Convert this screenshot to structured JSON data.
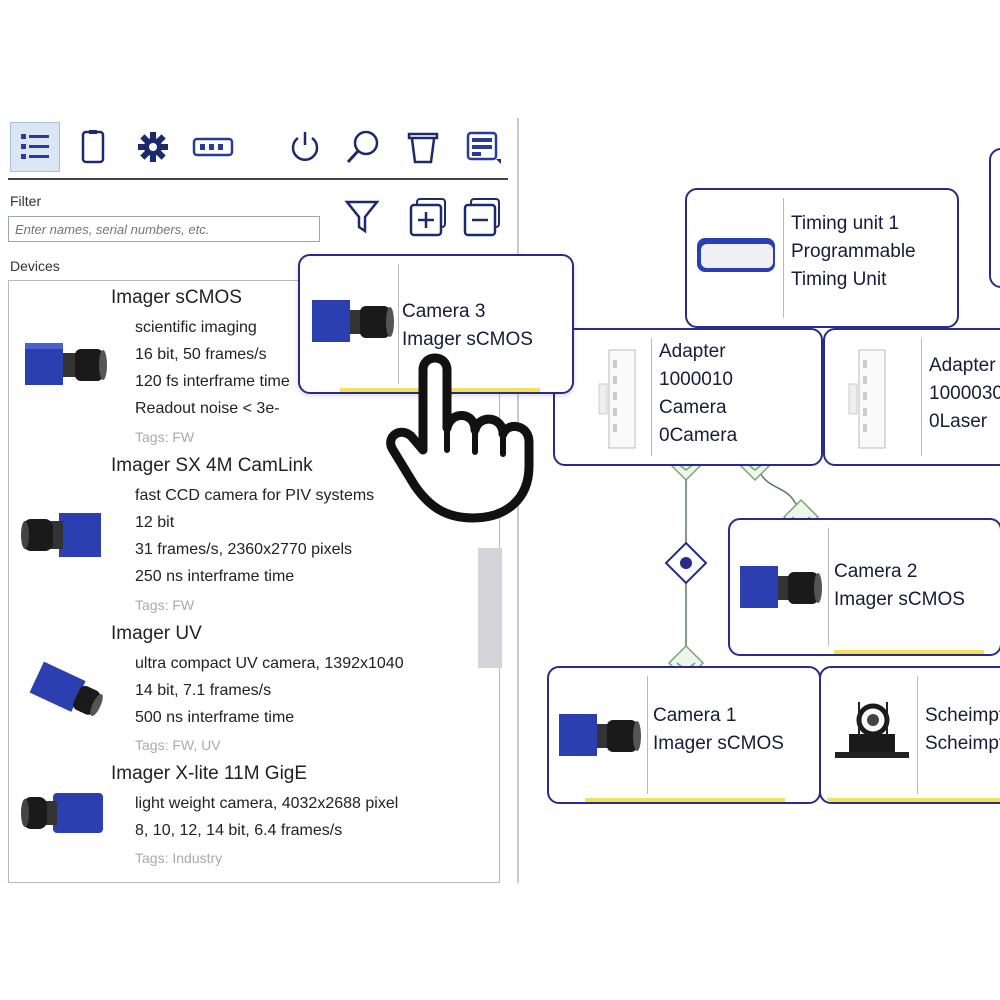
{
  "toolbar": {
    "buttons": [
      {
        "name": "list-view-icon",
        "active": true
      },
      {
        "name": "clipboard-icon"
      },
      {
        "name": "gear-icon"
      },
      {
        "name": "module-icon"
      },
      {
        "name": "power-icon"
      },
      {
        "name": "search-icon"
      },
      {
        "name": "trash-icon"
      },
      {
        "name": "layout-icon"
      }
    ]
  },
  "filter": {
    "label": "Filter",
    "placeholder": "Enter names, serial numbers, etc."
  },
  "devices_label": "Devices",
  "devices": [
    {
      "title": "Imager sCMOS",
      "lines": [
        "scientific imaging",
        "16 bit, 50 frames/s",
        "120 fs interframe time",
        "Readout noise < 3e-"
      ],
      "tag": "Tags: FW"
    },
    {
      "title": "Imager SX 4M CamLink",
      "lines": [
        "fast CCD camera for PIV systems",
        "12 bit",
        "31 frames/s, 2360x2770 pixels",
        "250 ns interframe time"
      ],
      "tag": "Tags: FW"
    },
    {
      "title": "Imager UV",
      "lines": [
        "ultra compact UV camera, 1392x1040",
        "14 bit, 7.1 frames/s",
        "500 ns interframe time"
      ],
      "tag": "Tags: FW, UV"
    },
    {
      "title": "Imager X-lite 11M GigE",
      "lines": [
        "light weight camera, 4032x2688 pixel",
        "8, 10, 12, 14 bit, 6.4 frames/s"
      ],
      "tag": "Tags: Industry"
    }
  ],
  "drag_node": {
    "lines": [
      "Camera 3",
      "Imager sCMOS"
    ]
  },
  "diagram": {
    "timing": {
      "lines": [
        "Timing unit 1",
        "Programmable",
        "Timing Unit"
      ]
    },
    "adapter1": {
      "lines": [
        "Adapter",
        "1000010",
        "Camera",
        "0Camera"
      ]
    },
    "adapter2": {
      "lines": [
        "Adapter",
        "1000030",
        "0Laser"
      ]
    },
    "camera2": {
      "lines": [
        "Camera 2",
        "Imager sCMOS"
      ]
    },
    "camera1": {
      "lines": [
        "Camera 1",
        "Imager sCMOS"
      ]
    },
    "scheimpflug": {
      "lines": [
        "Scheimpflug",
        "Scheimpflug"
      ]
    }
  },
  "colors": {
    "accent": "#2a2a8a",
    "highlight": "#f2e25a",
    "connector": "#6a9a6a",
    "camera_blue": "#2b3fb0"
  }
}
